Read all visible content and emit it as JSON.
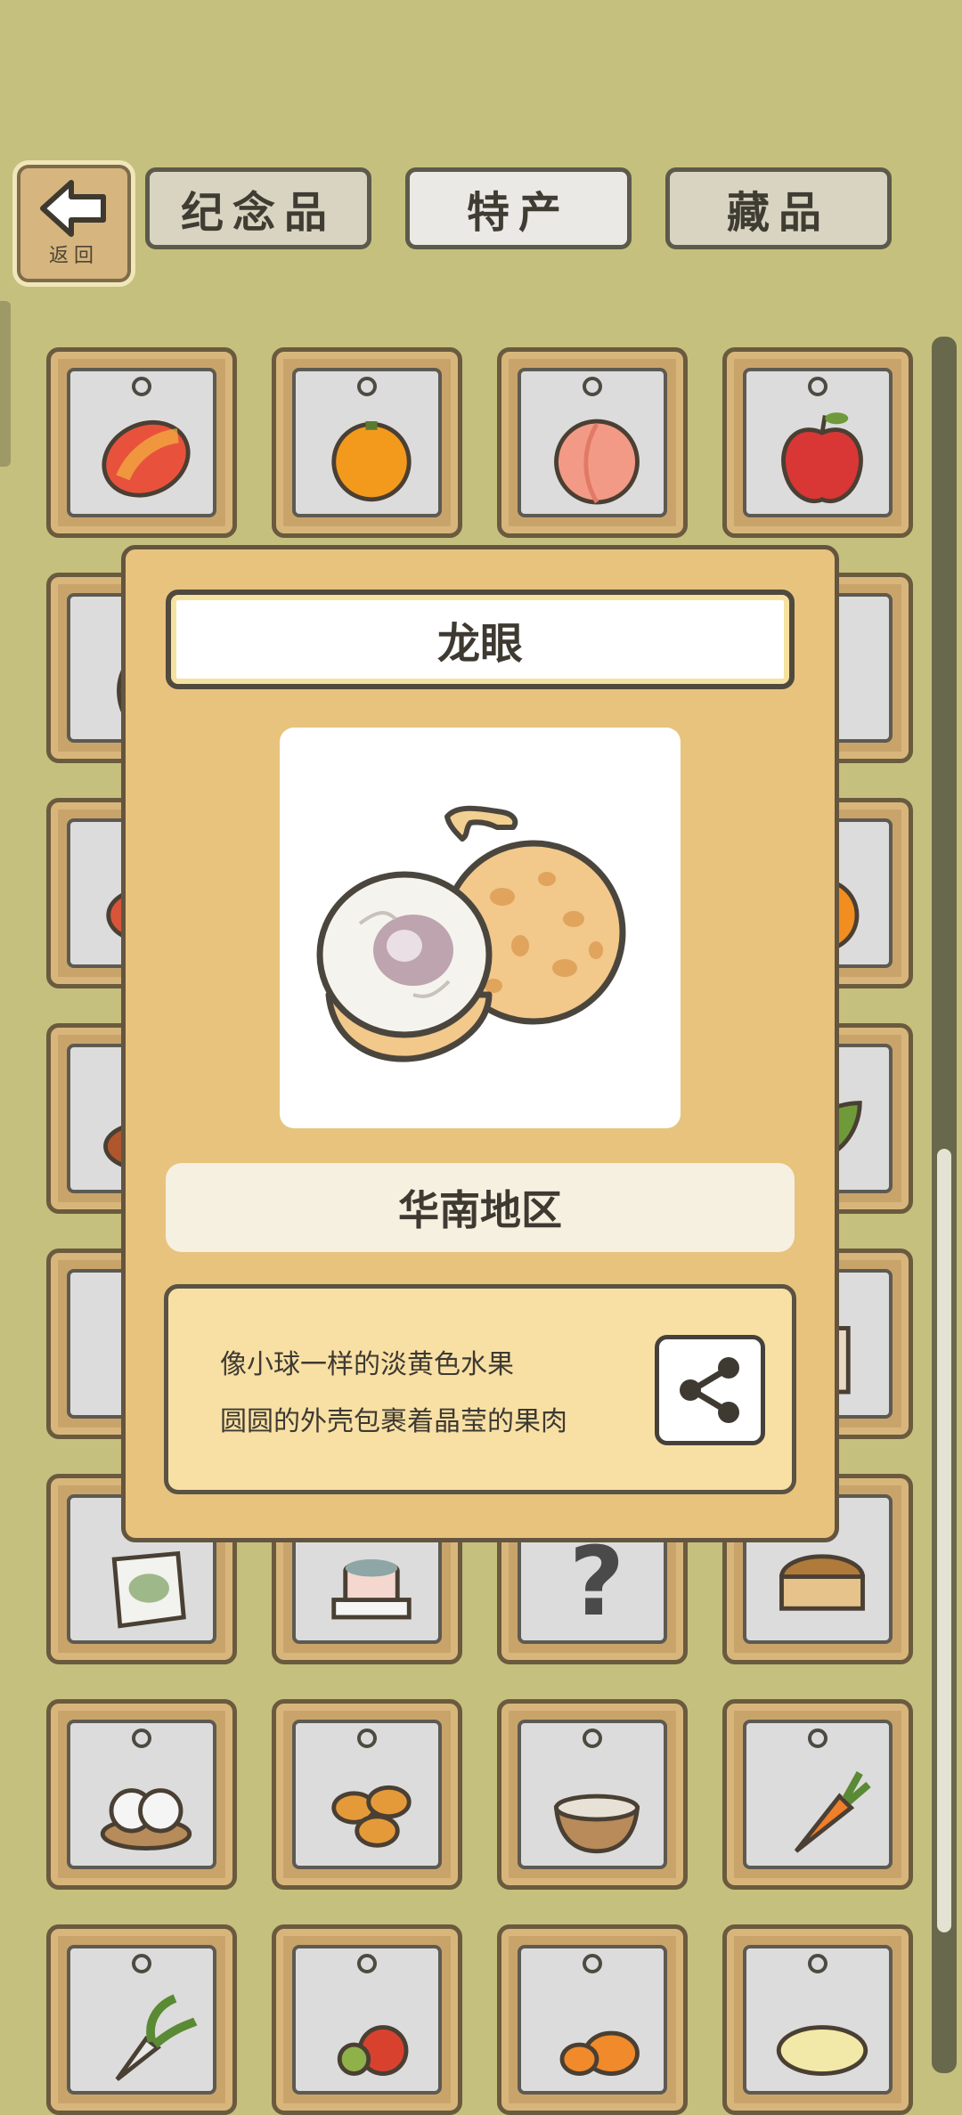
{
  "nav": {
    "back_label": "返回",
    "tabs": [
      {
        "label": "纪念品",
        "state": "inactive"
      },
      {
        "label": "特产",
        "state": "active"
      },
      {
        "label": "藏品",
        "state": "inactive"
      }
    ]
  },
  "grid": {
    "items": [
      {
        "icon": "mango-icon"
      },
      {
        "icon": "orange-icon"
      },
      {
        "icon": "peach-icon"
      },
      {
        "icon": "apple-icon"
      },
      {
        "icon": "vase-icon"
      },
      {
        "icon": "unknown-icon"
      },
      {
        "icon": "unknown-icon"
      },
      {
        "icon": "unknown-icon"
      },
      {
        "icon": "crab-icon"
      },
      {
        "icon": "unknown-icon"
      },
      {
        "icon": "unknown-icon"
      },
      {
        "icon": "persimmon-icon"
      },
      {
        "icon": "stew-icon"
      },
      {
        "icon": "unknown-icon"
      },
      {
        "icon": "unknown-icon"
      },
      {
        "icon": "leaf-icon"
      },
      {
        "icon": "berries-icon"
      },
      {
        "icon": "unknown-icon"
      },
      {
        "icon": "unknown-icon"
      },
      {
        "icon": "scroll-icon"
      },
      {
        "icon": "dumpling-bag-icon"
      },
      {
        "icon": "mooncake-icon"
      },
      {
        "icon": "question-icon"
      },
      {
        "icon": "tea-cake-icon"
      },
      {
        "icon": "steamed-dumplings-icon"
      },
      {
        "icon": "egg-tarts-icon"
      },
      {
        "icon": "porridge-icon"
      },
      {
        "icon": "carrot-icon"
      },
      {
        "icon": "radish-icon"
      },
      {
        "icon": "tomatoes-icon"
      },
      {
        "icon": "pumpkins-icon"
      },
      {
        "icon": "noodles-icon"
      }
    ]
  },
  "popup": {
    "title": "龙眼",
    "image_icon": "longan-icon",
    "region": "华南地区",
    "description_lines": [
      "像小球一样的淡黄色水果",
      "圆圆的外壳包裹着晶莹的果肉"
    ],
    "share_icon": "share-icon"
  },
  "colors": {
    "background": "#c5c07e",
    "modal": "#e8c37e",
    "frame": "#c9a46a"
  }
}
